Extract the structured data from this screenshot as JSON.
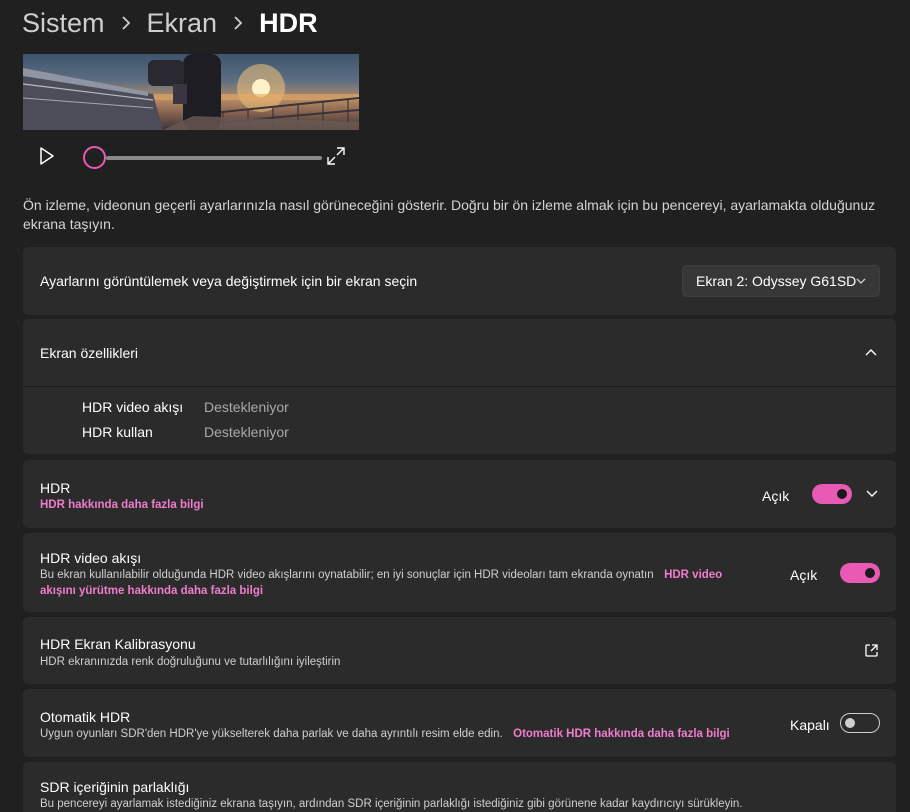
{
  "breadcrumb": {
    "items": [
      "Sistem",
      "Ekran",
      "HDR"
    ]
  },
  "preview": {
    "description": "Ön izleme, videonun geçerli ayarlarınızla nasıl görüneceğini gösterir. Doğru bir ön izleme almak için bu pencereyi, ayarlamakta olduğunuz ekrana taşıyın.",
    "playback_progress": 0.0
  },
  "display_select": {
    "label": "Ayarlarını görüntülemek veya değiştirmek için bir ekran seçin",
    "selected": "Ekran 2: Odyssey G61SD"
  },
  "display_properties": {
    "title": "Ekran özellikleri",
    "rows": [
      {
        "label": "HDR video akışı",
        "value": "Destekleniyor"
      },
      {
        "label": "HDR kullan",
        "value": "Destekleniyor"
      }
    ]
  },
  "hdr": {
    "title": "HDR",
    "link": "HDR hakkında daha fazla bilgi",
    "state": "Açık",
    "enabled": true
  },
  "hdr_video": {
    "title": "HDR video akışı",
    "description": "Bu ekran kullanılabilir olduğunda HDR video akışlarını oynatabilir; en iyi sonuçlar için HDR videoları tam ekranda oynatın",
    "link_line1": "HDR video",
    "link_line2": "akışını yürütme hakkında daha fazla bilgi",
    "state": "Açık",
    "enabled": true
  },
  "calibration": {
    "title": "HDR Ekran Kalibrasyonu",
    "description": "HDR ekranınızda renk doğruluğunu ve tutarlılığını iyileştirin"
  },
  "auto_hdr": {
    "title": "Otomatik HDR",
    "description": "Uygun oyunları SDR'den HDR'ye yükselterek daha parlak ve daha ayrıntılı resim elde edin.",
    "link": "Otomatik HDR hakkında daha fazla bilgi",
    "state": "Kapalı",
    "enabled": false
  },
  "sdr_brightness": {
    "title": "SDR içeriğinin parlaklığı",
    "description": "Bu pencereyi ayarlamak istediğiniz ekrana taşıyın, ardından SDR içeriğinin parlaklığı istediğiniz gibi görünene kadar kaydırıcıyı sürükleyin."
  },
  "colors": {
    "accent": "#e85ab4",
    "link": "#f07ccd",
    "background": "#202020",
    "card": "#2b2b2b"
  },
  "icons": {
    "crumb_separator": "chevron-right-icon",
    "play": "play-icon",
    "expand": "fullscreen-icon",
    "dropdown": "chevron-down-icon",
    "collapse": "chevron-up-icon",
    "expand_section": "chevron-down-icon",
    "external": "open-external-icon"
  }
}
